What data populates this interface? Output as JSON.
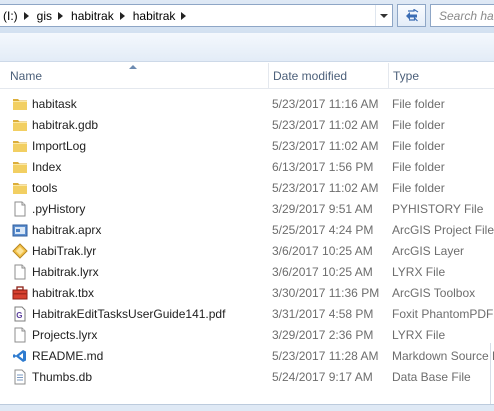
{
  "address_bar": {
    "crumbs": [
      "(I:)",
      "gis",
      "habitrak",
      "habitrak"
    ],
    "search_placeholder": "Search hab"
  },
  "columns": {
    "name": "Name",
    "date": "Date modified",
    "type": "Type"
  },
  "files": [
    {
      "name": "habitask",
      "date": "5/23/2017 11:16 AM",
      "type": "File folder",
      "icon": "folder-icon"
    },
    {
      "name": "habitrak.gdb",
      "date": "5/23/2017 11:02 AM",
      "type": "File folder",
      "icon": "folder-icon"
    },
    {
      "name": "ImportLog",
      "date": "5/23/2017 11:02 AM",
      "type": "File folder",
      "icon": "folder-icon"
    },
    {
      "name": "Index",
      "date": "6/13/2017 1:56 PM",
      "type": "File folder",
      "icon": "folder-icon"
    },
    {
      "name": "tools",
      "date": "5/23/2017 11:02 AM",
      "type": "File folder",
      "icon": "folder-icon"
    },
    {
      "name": ".pyHistory",
      "date": "3/29/2017 9:51 AM",
      "type": "PYHISTORY File",
      "icon": "blank-file-icon"
    },
    {
      "name": "habitrak.aprx",
      "date": "5/25/2017 4:24 PM",
      "type": "ArcGIS Project File",
      "icon": "arcgis-project-icon"
    },
    {
      "name": "HabiTrak.lyr",
      "date": "3/6/2017 10:25 AM",
      "type": "ArcGIS Layer",
      "icon": "arcgis-layer-icon"
    },
    {
      "name": "Habitrak.lyrx",
      "date": "3/6/2017 10:25 AM",
      "type": "LYRX File",
      "icon": "blank-file-icon"
    },
    {
      "name": "habitrak.tbx",
      "date": "3/30/2017 11:36 PM",
      "type": "ArcGIS Toolbox",
      "icon": "toolbox-icon"
    },
    {
      "name": "HabitrakEditTasksUserGuide141.pdf",
      "date": "3/31/2017 4:58 PM",
      "type": "Foxit PhantomPDF D",
      "icon": "pdf-icon"
    },
    {
      "name": "Projects.lyrx",
      "date": "3/29/2017 2:36 PM",
      "type": "LYRX File",
      "icon": "blank-file-icon"
    },
    {
      "name": "README.md",
      "date": "5/23/2017 11:28 AM",
      "type": "Markdown Source Fi",
      "icon": "vscode-file-icon"
    },
    {
      "name": "Thumbs.db",
      "date": "5/24/2017 9:17 AM",
      "type": "Data Base File",
      "icon": "db-file-icon"
    }
  ],
  "colors": {
    "header_text": "#4c607a",
    "meta_text": "#6d6d6d",
    "folder": "#e8c04a"
  }
}
